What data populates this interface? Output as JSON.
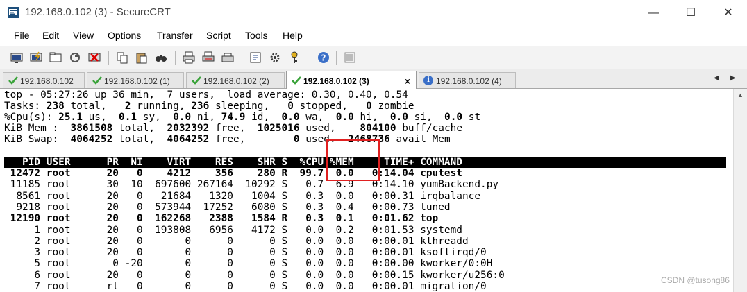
{
  "window": {
    "title": "192.168.0.102 (3) - SecureCRT",
    "minimize": "—",
    "maximize": "☐",
    "close": "✕"
  },
  "menu": [
    "File",
    "Edit",
    "View",
    "Options",
    "Transfer",
    "Script",
    "Tools",
    "Help"
  ],
  "tabs": [
    {
      "label": "192.168.0.102",
      "status": "connected"
    },
    {
      "label": "192.168.0.102 (1)",
      "status": "connected"
    },
    {
      "label": "192.168.0.102 (2)",
      "status": "connected"
    },
    {
      "label": "192.168.0.102 (3)",
      "status": "connected",
      "active": true,
      "close": "×"
    },
    {
      "label": "192.168.0.102 (4)",
      "status": "info"
    }
  ],
  "tab_scroll": {
    "left": "◀",
    "right": "▶"
  },
  "colors": {
    "connected_check": "#3aa33a",
    "highlight": "#e02020",
    "header_bg": "#000000"
  },
  "terminal": {
    "summary": {
      "line1": "top - 05:27:26 up 36 min,  7 users,  load average: 0.30, 0.40, 0.54",
      "tasks_pre": "Tasks: ",
      "tasks_total": "238",
      "tasks_total_lbl": " total,   ",
      "tasks_running": "2",
      "tasks_running_lbl": " running, ",
      "tasks_sleeping": "236",
      "tasks_sleeping_lbl": " sleeping,   ",
      "tasks_stopped": "0",
      "tasks_stopped_lbl": " stopped,   ",
      "tasks_zombie": "0",
      "tasks_zombie_lbl": " zombie",
      "cpu_pre": "%Cpu(s): ",
      "cpu_us": "25.1",
      "cpu_us_lbl": " us,  ",
      "cpu_sy": "0.1",
      "cpu_sy_lbl": " sy,  ",
      "cpu_ni": "0.0",
      "cpu_ni_lbl": " ni, ",
      "cpu_id": "74.9",
      "cpu_id_lbl": " id,  ",
      "cpu_wa": "0.0",
      "cpu_wa_lbl": " wa,  ",
      "cpu_hi": "0.0",
      "cpu_hi_lbl": " hi,  ",
      "cpu_si": "0.0",
      "cpu_si_lbl": " si,  ",
      "cpu_st": "0.0",
      "cpu_st_lbl": " st",
      "mem_pre": "KiB Mem :  ",
      "mem_total": "3861508",
      "mem_total_lbl": " total,  ",
      "mem_free": "2032392",
      "mem_free_lbl": " free,  ",
      "mem_used": "1025016",
      "mem_used_lbl": " used,    ",
      "mem_cache": "804100",
      "mem_cache_lbl": " buff/cache",
      "swap_pre": "KiB Swap:  ",
      "swap_total": "4064252",
      "swap_total_lbl": " total,  ",
      "swap_free": "4064252",
      "swap_free_lbl": " free,        ",
      "swap_used": "0",
      "swap_used_lbl": " used.  ",
      "swap_avail": "2468736",
      "swap_avail_lbl": " avail Mem"
    },
    "header": "   PID USER      PR  NI    VIRT    RES    SHR S  %CPU %MEM     TIME+ COMMAND",
    "rows": [
      {
        "text": " 12472 root      20   0    4212    356    280 R  99.7  0.0   0:14.04 cputest",
        "bold": true
      },
      {
        "text": " 11185 root      30  10  697600 267164  10292 S   0.7  6.9   0:14.10 yumBackend.py",
        "bold": false
      },
      {
        "text": "  8561 root      20   0   21684   1320   1004 S   0.3  0.0   0:00.31 irqbalance",
        "bold": false
      },
      {
        "text": "  9218 root      20   0  573944  17252   6080 S   0.3  0.4   0:00.73 tuned",
        "bold": false
      },
      {
        "text": " 12190 root      20   0  162268   2388   1584 R   0.3  0.1   0:01.62 top",
        "bold": true
      },
      {
        "text": "     1 root      20   0  193808   6956   4172 S   0.0  0.2   0:01.53 systemd",
        "bold": false
      },
      {
        "text": "     2 root      20   0       0      0      0 S   0.0  0.0   0:00.01 kthreadd",
        "bold": false
      },
      {
        "text": "     3 root      20   0       0      0      0 S   0.0  0.0   0:00.01 ksoftirqd/0",
        "bold": false
      },
      {
        "text": "     5 root       0 -20       0      0      0 S   0.0  0.0   0:00.00 kworker/0:0H",
        "bold": false
      },
      {
        "text": "     6 root      20   0       0      0      0 S   0.0  0.0   0:00.15 kworker/u256:0",
        "bold": false
      },
      {
        "text": "     7 root      rt   0       0      0      0 S   0.0  0.0   0:00.01 migration/0",
        "bold": false
      }
    ]
  },
  "scrollbar": {
    "up": "▲"
  },
  "watermark": "CSDN @tusong86"
}
